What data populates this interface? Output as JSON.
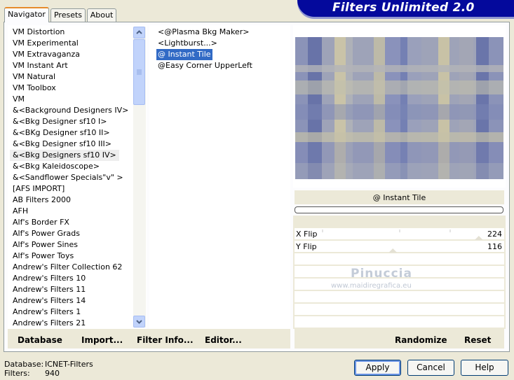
{
  "tabs": [
    {
      "label": "Navigator",
      "active": true
    },
    {
      "label": "Presets",
      "active": false
    },
    {
      "label": "About",
      "active": false
    }
  ],
  "banner_title": "Filters Unlimited 2.0",
  "categories": [
    "VM Distortion",
    "VM Experimental",
    "VM Extravaganza",
    "VM Instant Art",
    "VM Natural",
    "VM Toolbox",
    "VM",
    "&<Background Designers IV>",
    "&<Bkg Designer sf10 I>",
    "&<BKg Designer sf10 II>",
    "&<Bkg Designer sf10 III>",
    "&<Bkg Designers sf10 IV>",
    "&<Bkg Kaleidoscope>",
    "&<Sandflower Specials\"v\" >",
    "[AFS IMPORT]",
    "AB Filters 2000",
    "AFH",
    "Alf's Border FX",
    "Alf's Power Grads",
    "Alf's Power Sines",
    "Alf's Power Toys",
    "Andrew's Filter Collection 62",
    "Andrew's Filters 10",
    "Andrew's Filters 11",
    "Andrew's Filters 14",
    "Andrew's Filters 1",
    "Andrew's Filters 21"
  ],
  "selected_category_index": 11,
  "filters": [
    "<@Plasma Bkg Maker>",
    "<Lightburst...>",
    "@ Instant Tile",
    "@Easy Corner UpperLeft"
  ],
  "selected_filter_index": 2,
  "filter_name": "@ Instant Tile",
  "params": [
    {
      "label": "X Flip",
      "value": "224",
      "level": 0.88
    },
    {
      "label": "Y Flip",
      "value": "116",
      "level": 0.45
    }
  ],
  "watermark": {
    "name": "Pinuccia",
    "url": "www.maidiregrafica.eu"
  },
  "toolbar": {
    "database": "Database",
    "import": "Import...",
    "filter_info": "Filter Info...",
    "editor": "Editor...",
    "randomize": "Randomize",
    "reset": "Reset"
  },
  "status": {
    "database_label": "Database:",
    "database_value": "ICNET-Filters",
    "filters_label": "Filters:",
    "filters_value": "940"
  },
  "buttons": {
    "apply": "Apply",
    "cancel": "Cancel",
    "help": "Help"
  },
  "colors": {
    "accent": "#316ac5",
    "banner": "#04099c",
    "tab_highlight": "#e68b2c"
  }
}
